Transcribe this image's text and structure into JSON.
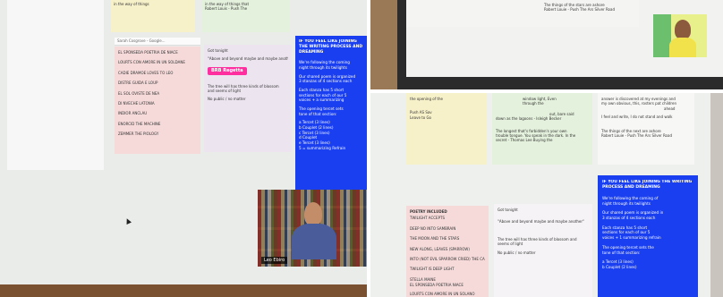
{
  "app": {
    "toolbar_text": "Sarah Cosgrove - Google..."
  },
  "left_panel": {
    "yellow_card": {
      "lines": [
        "in the way of things"
      ]
    },
    "green_card": {
      "lines": [
        "in the way of things that",
        "Robert Louis - Push The"
      ]
    },
    "pink_card": {
      "items": [
        "EL SPONSEDA POETRIA DE NIACE",
        "LOURTS CON AMORE IN UN SOLDANE",
        "CADIE DRAMOE LOVES TO LEO",
        "DISTRE GUIDA E LOUP",
        "EL SOL OVISTE DE NEA",
        "DI NVECHE LATONIA",
        "INDIOR ANCLAU",
        "ENORCID THE MACHINE",
        "ZEMMER THE PIOLOGY"
      ]
    },
    "lav_card": {
      "lines": [
        "Got tonight",
        "\"Above and beyond maybe and maybe another\""
      ],
      "highlight": "BRB Regetta",
      "after": [
        "The tree will has three kinds of blossom",
        "and seems of light",
        "No public / no matter"
      ]
    },
    "blue_card": {
      "heading": "IF YOU FEEL LIKE JOINING THE WRITING PROCESS AND DREAMING",
      "lines": [
        "We're following the coming",
        "night through its twilights",
        "Our shared poem is organized",
        "3 stanzas of 4 sections each",
        "Each stanza has 5 short",
        "sections for each of our 5",
        "voices + a summarizing",
        "The opening tercet sets",
        "tone of that section:",
        "a Tercet (3 lines)",
        "b Couplet (2 lines)",
        "c Tercet (3 lines)",
        "d Couplet",
        "e Tercet (3 lines)",
        "5 = summarizing Refrain"
      ]
    },
    "video": {
      "name": "Leo Ebiro"
    }
  },
  "tr_panel": {
    "green_lines": [
      "The things of the stars are ashore",
      "Robert Louie - Push The Ars Silver Road"
    ]
  },
  "br_panel": {
    "yellow_card": {
      "lines": [
        "the opening of the",
        "Push AS Sav",
        "Leave to Go"
      ]
    },
    "green_card_top": {
      "lines": [
        "window light, Even",
        "through the",
        "out, bare said",
        "down as the lagoons - Isleigh Becker"
      ]
    },
    "green_card_bottom": {
      "lines": [
        "The longest that's forbidden's your own",
        "trouble tongue. You speak in the dark. In the",
        "secret - Thomas Lee Buying the"
      ]
    },
    "right_top": {
      "lines": [
        "answer is discovered at my evenings and",
        "my own obvious, this, rosters pat children",
        "ahead",
        "I feel and write, I do not stand and walk",
        "The things of the next are ashore",
        "Robert Louie - Push The Ars Silver Road"
      ]
    },
    "pink_card": {
      "heading": "POETRY INCLUDED",
      "items": [
        "TWILIGHT ACCEPTS",
        "DEEP NO INTO SAMBRAIN",
        "THE MOON AND THE STARS",
        "NEW ALONG, LEAVES (SPARROW)",
        "INTO (NOT EVIL SPARROW CRIED) THE CALL",
        "TWILIGHT IS DEEP LIGHT",
        "STELLA MAINE",
        "EL SPONSEDA POETRIA NIACE",
        "LOURTS CON AMORE IN UN SOLANO"
      ]
    },
    "lav_card": {
      "lines": [
        "Got tonight",
        "\"Above and beyond maybe and maybe another\"",
        "The tree will has three kinds of blossom and",
        "seems of light",
        "No public / no matter"
      ]
    },
    "blue_card": {
      "heading": "IF YOU FEEL LIKE JOINING THE WRITING PROCESS AND DREAMING",
      "lines": [
        "We're following the coming of",
        "night through its twilights",
        "Our shared poem is organized in",
        "3 stanzas of 4 sections each",
        "Each stanza has 5 short",
        "sections for each of our 5",
        "voices + 1 summarizing refrain",
        "The opening tercet sets the",
        "tone of that section:",
        "a Tercet (3 lines)",
        "b Couplet (2 lines)"
      ]
    }
  }
}
